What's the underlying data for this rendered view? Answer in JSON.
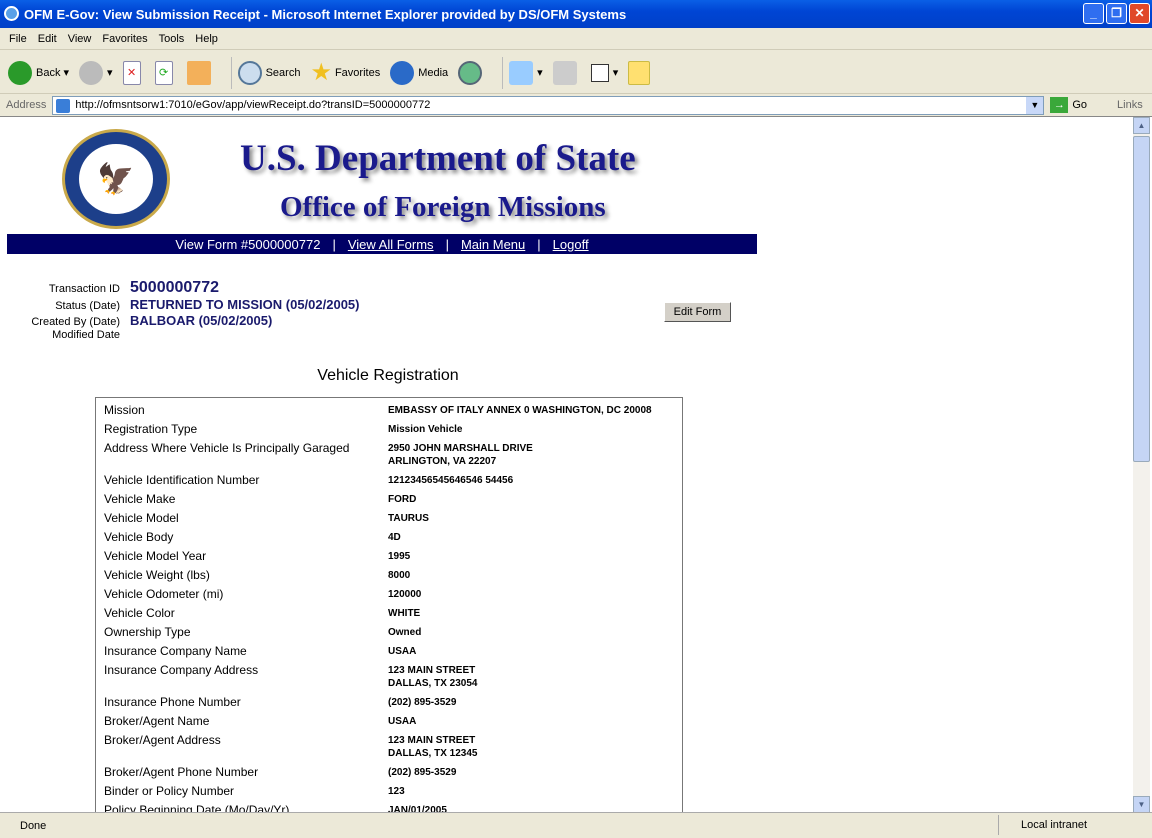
{
  "window": {
    "title": "OFM E-Gov: View Submission Receipt - Microsoft Internet Explorer provided by DS/OFM Systems"
  },
  "menu": [
    "File",
    "Edit",
    "View",
    "Favorites",
    "Tools",
    "Help"
  ],
  "toolbar": {
    "back": "Back",
    "search": "Search",
    "favorites": "Favorites",
    "media": "Media"
  },
  "address": {
    "label": "Address",
    "url": "http://ofmsntsorw1:7010/eGov/app/viewReceipt.do?transID=5000000772",
    "go": "Go",
    "links": "Links"
  },
  "header": {
    "title": "U.S. Department of State",
    "subtitle": "Office of Foreign Missions",
    "seal_text": "DEPARTMENT OF STATE · UNITED STATES OF AMERICA"
  },
  "nav": {
    "current": "View Form #5000000772",
    "view_all": "View All Forms",
    "main_menu": "Main Menu",
    "logoff": "Logoff",
    "sep": "|"
  },
  "info": {
    "transaction_id_label": "Transaction ID",
    "transaction_id": "5000000772",
    "status_label": "Status (Date)",
    "status": "RETURNED TO MISSION (05/02/2005)",
    "created_label": "Created By (Date)",
    "created": "BALBOAR (05/02/2005)",
    "modified_label": "Modified Date"
  },
  "edit_button": "Edit Form",
  "form_title": "Vehicle Registration",
  "rows": [
    {
      "k": "Mission",
      "v": "EMBASSY OF ITALY ANNEX 0 WASHINGTON, DC 20008"
    },
    {
      "k": "Registration Type",
      "v": "Mission Vehicle"
    },
    {
      "k": "Address Where Vehicle Is Principally Garaged",
      "v": "2950 JOHN MARSHALL DRIVE",
      "v2": "ARLINGTON, VA 22207"
    },
    {
      "k": "Vehicle Identification Number",
      "v": "12123456545646546 54456"
    },
    {
      "k": "Vehicle Make",
      "v": "FORD"
    },
    {
      "k": "Vehicle Model",
      "v": "TAURUS"
    },
    {
      "k": "Vehicle Body",
      "v": "4D"
    },
    {
      "k": "Vehicle Model Year",
      "v": "1995"
    },
    {
      "k": "Vehicle Weight (lbs)",
      "v": "8000"
    },
    {
      "k": "Vehicle Odometer (mi)",
      "v": "120000"
    },
    {
      "k": "Vehicle Color",
      "v": "WHITE"
    },
    {
      "k": "Ownership Type",
      "v": "Owned"
    },
    {
      "k": "Insurance Company Name",
      "v": "USAA"
    },
    {
      "k": "Insurance Company Address",
      "v": "123 MAIN STREET",
      "v2": "DALLAS, TX 23054"
    },
    {
      "k": "Insurance Phone Number",
      "v": "(202) 895-3529"
    },
    {
      "k": "Broker/Agent Name",
      "v": "USAA"
    },
    {
      "k": "Broker/Agent Address",
      "v": "123 MAIN STREET",
      "v2": "DALLAS, TX 12345"
    },
    {
      "k": "Broker/Agent Phone Number",
      "v": "(202) 895-3529"
    },
    {
      "k": "Binder or Policy Number",
      "v": "123"
    },
    {
      "k": "Policy Beginning Date (Mo/Day/Yr)",
      "v": "JAN/01/2005"
    }
  ],
  "statusbar": {
    "text": "Done",
    "zone": "Local intranet"
  }
}
